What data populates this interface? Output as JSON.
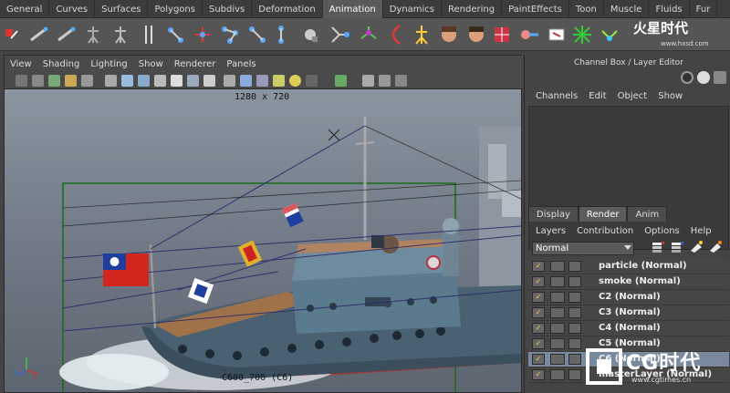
{
  "shelf": {
    "tabs": [
      "General",
      "Curves",
      "Surfaces",
      "Polygons",
      "Subdivs",
      "Deformation",
      "Animation",
      "Dynamics",
      "Rendering",
      "PaintEffects",
      "Toon",
      "Muscle",
      "Fluids",
      "Fur"
    ],
    "active_tab": "Animation"
  },
  "viewport": {
    "menu": [
      "View",
      "Shading",
      "Lighting",
      "Show",
      "Renderer",
      "Panels"
    ],
    "resolution": "1280 x 720",
    "camera": "C600_700 (C6)"
  },
  "channel_box": {
    "title": "Channel Box / Layer Editor",
    "menu": [
      "Channels",
      "Edit",
      "Object",
      "Show"
    ]
  },
  "layer_editor": {
    "tabs": [
      "Display",
      "Render",
      "Anim"
    ],
    "active_tab": "Render",
    "menu": [
      "Layers",
      "Contribution",
      "Options",
      "Help"
    ],
    "blend_mode": "Normal",
    "layers": [
      {
        "name": "particle (Normal)"
      },
      {
        "name": "smoke (Normal)"
      },
      {
        "name": "C2 (Normal)"
      },
      {
        "name": "C3 (Normal)"
      },
      {
        "name": "C4 (Normal)"
      },
      {
        "name": "C5 (Normal)"
      },
      {
        "name": "C6 (Normal)",
        "selected": true
      },
      {
        "name": "masterLayer (Normal)"
      }
    ]
  },
  "watermark": {
    "top_logo": "火星时代",
    "top_url": "www.hxsd.com",
    "bottom_logo": "CG时代",
    "bottom_url": "www.cgtimes.cn"
  },
  "colors": {
    "panel": "#444444",
    "selected_layer": "#7a8a9e",
    "flag_red": "#d2261e",
    "hull": "#4a6172",
    "deck": "#a0724a"
  }
}
